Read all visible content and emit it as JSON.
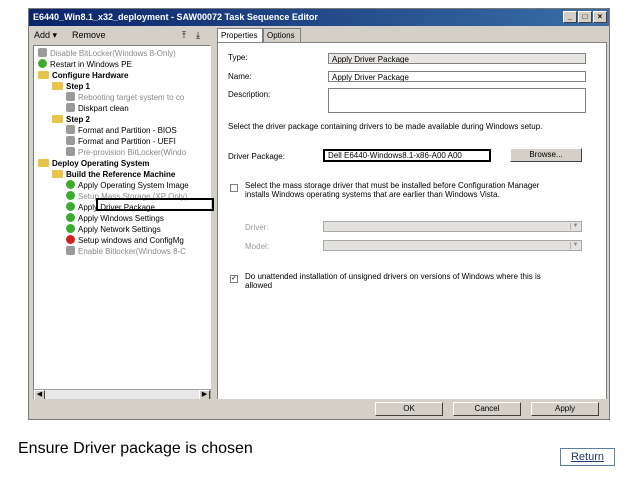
{
  "window": {
    "title": "E6440_Win8.1_x32_deployment - SAW00072 Task Sequence Editor",
    "buttons": [
      "_",
      "□",
      "×"
    ]
  },
  "toolbar": {
    "add_label": "Add ▾",
    "remove_label": "Remove"
  },
  "tree": {
    "items": [
      {
        "label": "Disable BitLocker(Windows 8-Only)",
        "icon": "gray-step-icon",
        "state": "disabled"
      },
      {
        "label": "Restart in Windows PE",
        "icon": "check-icon",
        "state": "normal"
      },
      {
        "label": "Configure Hardware",
        "icon": "folder-icon",
        "state": "group"
      },
      {
        "label": "Step 1",
        "icon": "folder-icon",
        "state": "group"
      },
      {
        "label": "Rebooting target system to co",
        "icon": "gray-step-icon",
        "state": "disabled"
      },
      {
        "label": "Diskpart clean",
        "icon": "gray-step-icon",
        "state": "normal"
      },
      {
        "label": "Step 2",
        "icon": "folder-icon",
        "state": "group"
      },
      {
        "label": "Format and Partition - BIOS",
        "icon": "gray-step-icon",
        "state": "normal"
      },
      {
        "label": "Format and Partition - UEFI",
        "icon": "gray-step-icon",
        "state": "normal"
      },
      {
        "label": "Pre-provision BitLocker(Windo",
        "icon": "gray-step-icon",
        "state": "disabled"
      },
      {
        "label": "Deploy Operating System",
        "icon": "folder-icon",
        "state": "group"
      },
      {
        "label": "Build the Reference Machine",
        "icon": "folder-icon",
        "state": "group"
      },
      {
        "label": "Apply Operating System Image",
        "icon": "check-icon",
        "state": "normal"
      },
      {
        "label": "Setup Mass Storage (XP Only)",
        "icon": "check-icon",
        "state": "disabled"
      },
      {
        "label": "Apply Driver Package",
        "icon": "check-icon",
        "state": "selected"
      },
      {
        "label": "Apply Windows Settings",
        "icon": "check-icon",
        "state": "normal"
      },
      {
        "label": "Apply Network Settings",
        "icon": "check-icon",
        "state": "normal"
      },
      {
        "label": "Setup windows and ConfigMg",
        "icon": "error-icon",
        "state": "normal"
      },
      {
        "label": "Enable Bitlocker(Windows 8-C",
        "icon": "gray-step-icon",
        "state": "disabled"
      }
    ]
  },
  "tabs": [
    {
      "label": "Properties"
    },
    {
      "label": "Options"
    }
  ],
  "properties": {
    "type_label": "Type:",
    "type_value": "Apply Driver Package",
    "name_label": "Name:",
    "name_value": "Apply Driver Package",
    "description_label": "Description:",
    "description_value": "",
    "instruction": "Select the driver package containing drivers to be made available during Windows setup.",
    "driver_package_label": "Driver Package:",
    "driver_package_value": "Dell E6440-Windows8.1-x86-A00 A00",
    "browse_label": "Browse...",
    "mass_storage_text_1": "Select the mass storage driver that must be installed before Configuration Manager",
    "mass_storage_text_2": "installs Windows operating systems that are earlier than Windows Vista.",
    "driver_label": "Driver:",
    "model_label": "Model:",
    "unattended_text_1": "Do unattended installation of unsigned drivers on versions of Windows where this is",
    "unattended_text_2": "allowed",
    "unattended_checked": "✓"
  },
  "footer": {
    "ok_label": "OK",
    "cancel_label": "Cancel",
    "apply_label": "Apply"
  },
  "caption": "Ensure Driver package is chosen",
  "return_label": "Return"
}
